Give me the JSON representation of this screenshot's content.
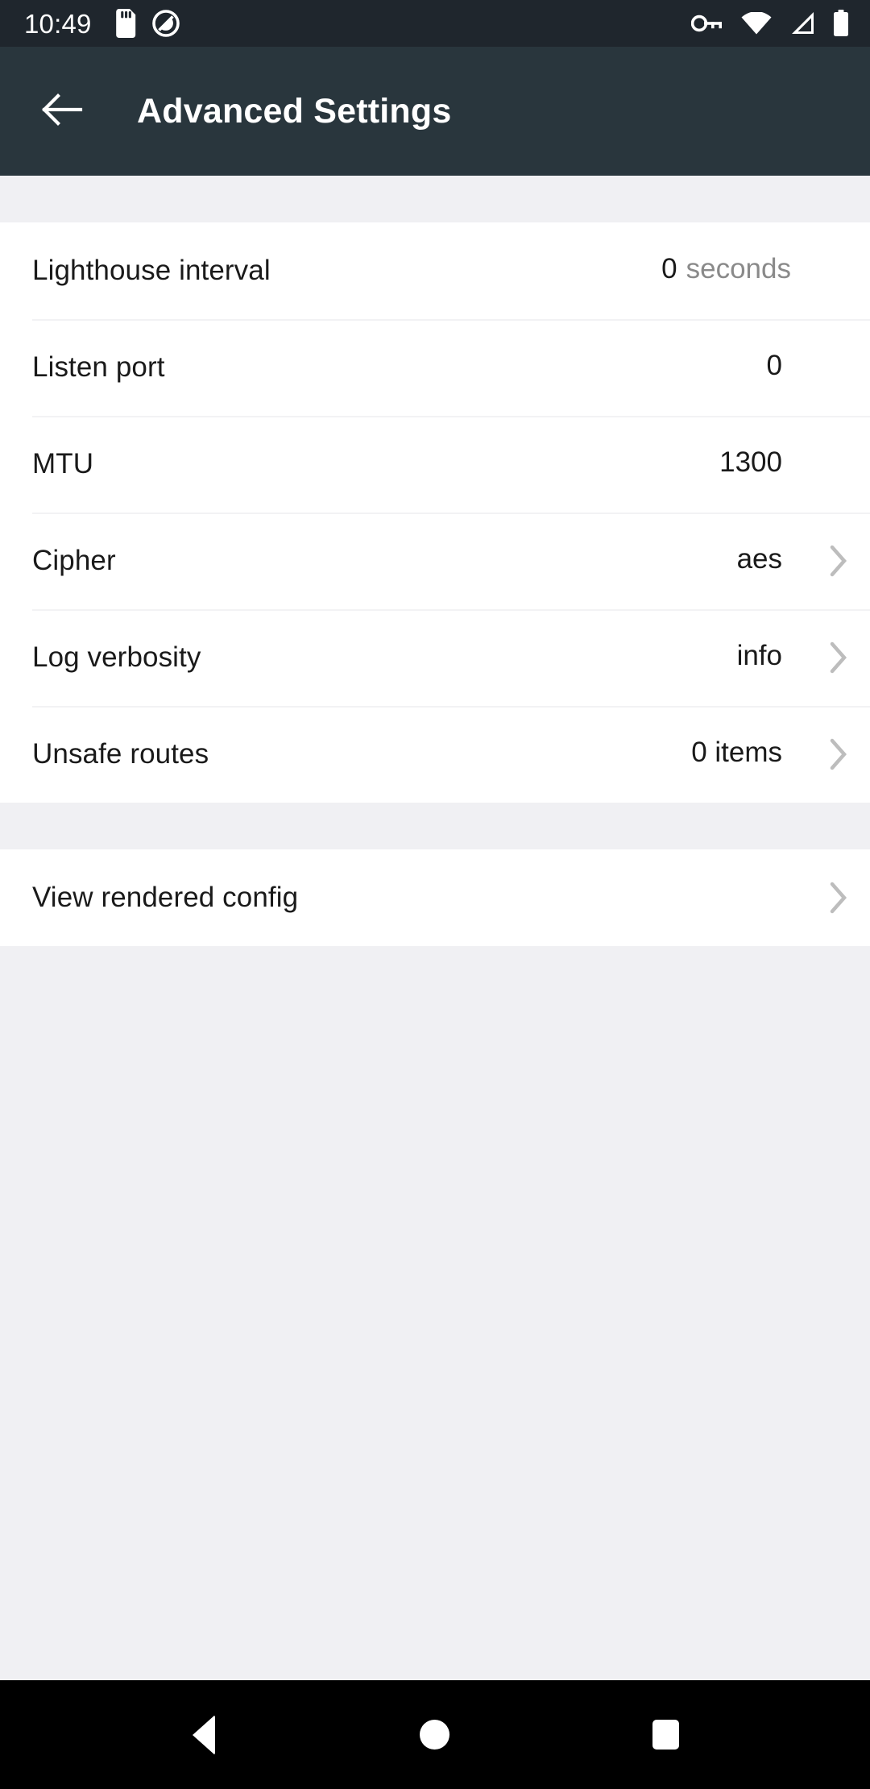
{
  "status_bar": {
    "time": "10:49",
    "left_icons": [
      "sd-card-icon",
      "do-not-disturb-icon"
    ],
    "right_icons": [
      "vpn-key-icon",
      "wifi-icon",
      "cellular-signal-icon",
      "battery-icon"
    ],
    "background_color": "#1f262d",
    "icon_color": "#ffffff"
  },
  "app_bar": {
    "back_icon": "arrow-back-icon",
    "title": "Advanced Settings",
    "background_color": "#29363d",
    "text_color": "#ffffff"
  },
  "settings": {
    "sections": [
      {
        "rows": [
          {
            "label": "Lighthouse interval",
            "value": "0",
            "unit": "seconds",
            "chevron": false
          },
          {
            "label": "Listen port",
            "value": "0",
            "unit": "",
            "chevron": false
          },
          {
            "label": "MTU",
            "value": "1300",
            "unit": "",
            "chevron": false
          },
          {
            "label": "Cipher",
            "value": "aes",
            "unit": "",
            "chevron": true
          },
          {
            "label": "Log verbosity",
            "value": "info",
            "unit": "",
            "chevron": true
          },
          {
            "label": "Unsafe routes",
            "value": "0 items",
            "unit": "",
            "chevron": true
          }
        ]
      },
      {
        "rows": [
          {
            "label": "View rendered config",
            "value": "",
            "unit": "",
            "chevron": true
          }
        ]
      }
    ],
    "colors": {
      "card_background": "#ffffff",
      "page_background": "#f0f0f3",
      "divider": "#f2f2f4",
      "label_text": "#1a1a1a",
      "unit_text": "#8a8a8a",
      "chevron": "#bdbdbd"
    }
  },
  "nav_bar": {
    "back_label": "back-button",
    "home_label": "home-button",
    "recents_label": "recents-button",
    "background_color": "#000000"
  }
}
